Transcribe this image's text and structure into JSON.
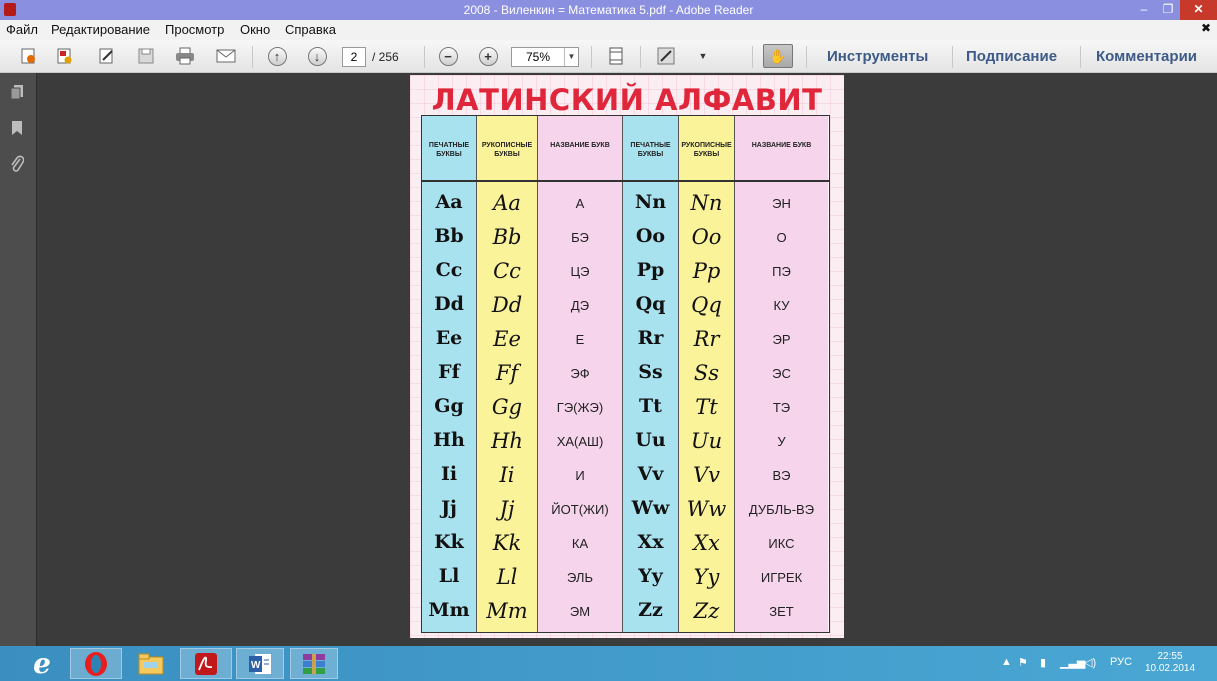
{
  "window": {
    "title": "2008 - Виленкин = Математика 5.pdf - Adobe Reader"
  },
  "menu": [
    "Файл",
    "Редактирование",
    "Просмотр",
    "Окно",
    "Справка"
  ],
  "toolbar": {
    "page_current": "2",
    "page_total": "/ 256",
    "zoom": "75%",
    "tools_label": "Инструменты",
    "sign_label": "Подписание",
    "comment_label": "Комментарии"
  },
  "document": {
    "title": "ЛАТИНСКИЙ АЛФАВИТ",
    "headers": [
      "ПЕЧАТНЫЕ БУКВЫ",
      "РУКОПИСНЫЕ БУКВЫ",
      "НАЗВАНИЕ БУКВ"
    ],
    "left_rows": [
      {
        "printed": "Aa",
        "script": "Aa",
        "name": "А"
      },
      {
        "printed": "Bb",
        "script": "Bb",
        "name": "БЭ"
      },
      {
        "printed": "Cc",
        "script": "Cc",
        "name": "ЦЭ"
      },
      {
        "printed": "Dd",
        "script": "Dd",
        "name": "ДЭ"
      },
      {
        "printed": "Ee",
        "script": "Ee",
        "name": "Е"
      },
      {
        "printed": "Ff",
        "script": "Ff",
        "name": "ЭФ"
      },
      {
        "printed": "Gg",
        "script": "Gg",
        "name": "ГЭ(ЖЭ)"
      },
      {
        "printed": "Hh",
        "script": "Hh",
        "name": "ХА(АШ)"
      },
      {
        "printed": "Ii",
        "script": "Ii",
        "name": "И"
      },
      {
        "printed": "Jj",
        "script": "Jj",
        "name": "ЙОТ(ЖИ)"
      },
      {
        "printed": "Kk",
        "script": "Kk",
        "name": "КА"
      },
      {
        "printed": "Ll",
        "script": "Ll",
        "name": "ЭЛЬ"
      },
      {
        "printed": "Mm",
        "script": "Mm",
        "name": "ЭМ"
      }
    ],
    "right_rows": [
      {
        "printed": "Nn",
        "script": "Nn",
        "name": "ЭН"
      },
      {
        "printed": "Oo",
        "script": "Oo",
        "name": "О"
      },
      {
        "printed": "Pp",
        "script": "Pp",
        "name": "ПЭ"
      },
      {
        "printed": "Qq",
        "script": "Qq",
        "name": "КУ"
      },
      {
        "printed": "Rr",
        "script": "Rr",
        "name": "ЭР"
      },
      {
        "printed": "Ss",
        "script": "Ss",
        "name": "ЭС"
      },
      {
        "printed": "Tt",
        "script": "Tt",
        "name": "ТЭ"
      },
      {
        "printed": "Uu",
        "script": "Uu",
        "name": "У"
      },
      {
        "printed": "Vv",
        "script": "Vv",
        "name": "ВЭ"
      },
      {
        "printed": "Ww",
        "script": "Ww",
        "name": "ДУБЛЬ-ВЭ"
      },
      {
        "printed": "Xx",
        "script": "Xx",
        "name": "ИКС"
      },
      {
        "printed": "Yy",
        "script": "Yy",
        "name": "ИГРЕК"
      },
      {
        "printed": "Zz",
        "script": "Zz",
        "name": "ЗЕТ"
      }
    ]
  },
  "taskbar": {
    "tray_lang": "РУС",
    "time": "22:55",
    "date": "10.02.2014"
  },
  "colors": {
    "title_bar": "#8b8fe0",
    "taskbar": "#3f9bcb",
    "doc_title_red": "#e0263a",
    "col_blue": "#a9e2ef",
    "col_yellow": "#fbf39a",
    "col_pink": "#f6d4ec",
    "panel_link": "#3d5b86"
  }
}
